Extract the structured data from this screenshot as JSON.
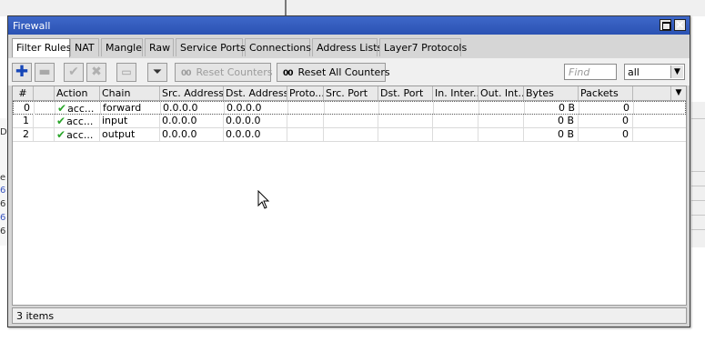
{
  "window": {
    "title": "Firewall"
  },
  "tabs": [
    "Filter Rules",
    "NAT",
    "Mangle",
    "Raw",
    "Service Ports",
    "Connections",
    "Address Lists",
    "Layer7 Protocols"
  ],
  "toolbar": {
    "add_icon": "plus-icon",
    "remove_icon": "minus-icon",
    "enable_icon": "check-icon",
    "disable_icon": "x-icon",
    "comment_icon": "comment-icon",
    "filter_icon": "funnel-icon",
    "reset_counters": "Reset Counters",
    "reset_all_counters": "Reset All Counters",
    "counter_glyph": "00"
  },
  "search": {
    "placeholder": "Find",
    "scope": "all"
  },
  "table": {
    "columns": [
      "#",
      "",
      "Action",
      "Chain",
      "Src. Address",
      "Dst. Address",
      "Proto...",
      "Src. Port",
      "Dst. Port",
      "In. Inter...",
      "Out. Int...",
      "Bytes",
      "Packets"
    ],
    "rows": [
      {
        "num": "0",
        "action": "acc...",
        "chain": "forward",
        "src": "0.0.0.0",
        "dst": "0.0.0.0",
        "bytes": "0 B",
        "packets": "0"
      },
      {
        "num": "1",
        "action": "acc...",
        "chain": "input",
        "src": "0.0.0.0",
        "dst": "0.0.0.0",
        "bytes": "0 B",
        "packets": "0"
      },
      {
        "num": "2",
        "action": "acc...",
        "chain": "output",
        "src": "0.0.0.0",
        "dst": "0.0.0.0",
        "bytes": "0 B",
        "packets": "0"
      }
    ]
  },
  "status": "3 items",
  "colors": {
    "titlebar": "#2f58bd",
    "accept_check": "#2aa52a",
    "add_icon": "#1747b8"
  }
}
